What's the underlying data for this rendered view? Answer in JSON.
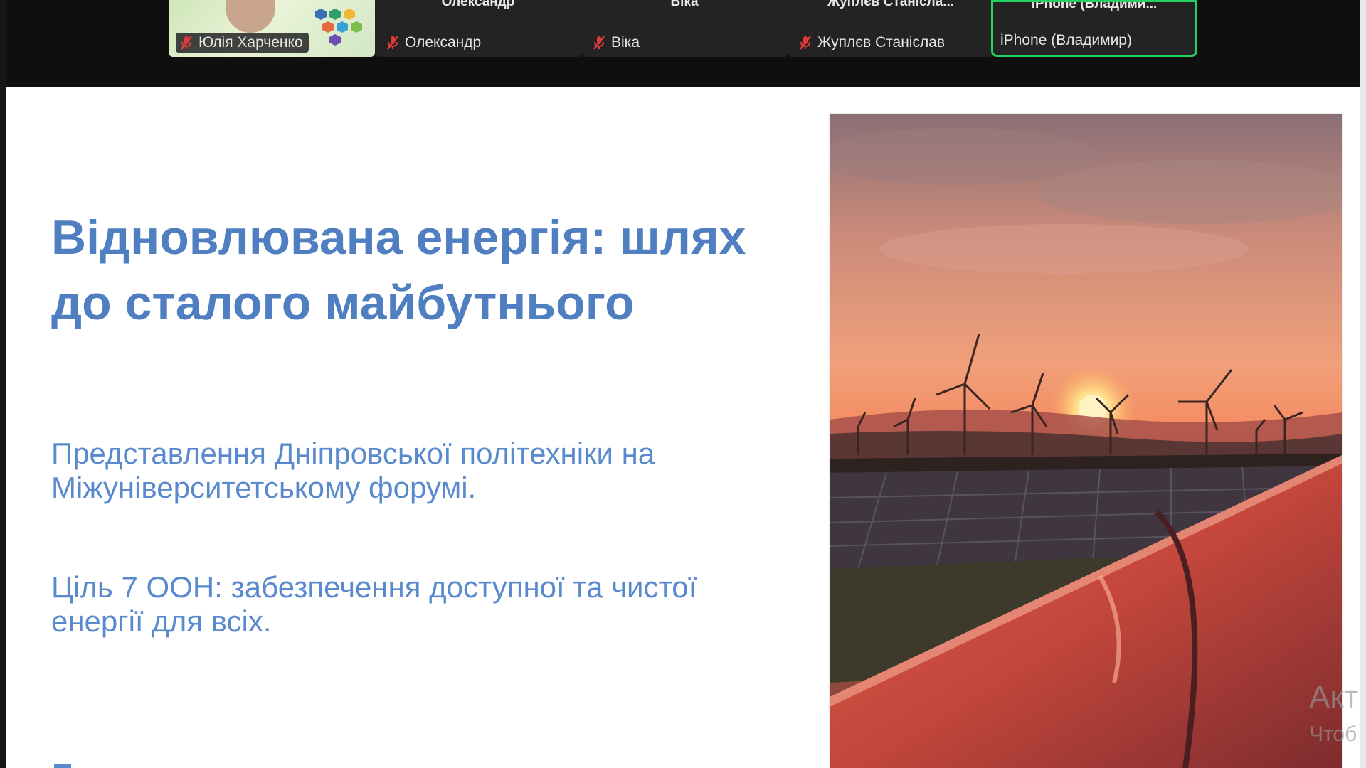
{
  "participants": [
    {
      "name": "Юлія Харченко",
      "top_name": "",
      "muted": true,
      "has_video": true,
      "active": false
    },
    {
      "name": "Олександр",
      "top_name": "Олександр",
      "muted": true,
      "has_video": false,
      "active": false
    },
    {
      "name": "Віка",
      "top_name": "Віка",
      "muted": true,
      "has_video": false,
      "active": false
    },
    {
      "name": "Жуплєв Станіслав",
      "top_name": "Жуплєв Станісла...",
      "muted": true,
      "has_video": false,
      "active": false
    },
    {
      "name": "iPhone (Владимир)",
      "top_name": "iPhone (Владими...",
      "muted": false,
      "has_video": false,
      "active": true
    }
  ],
  "slide": {
    "title": "Відновлювана енергія: шлях до сталого майбутнього",
    "subtitle_1": "Представлення Дніпровської політехніки на Міжуніверситетському форумі.",
    "subtitle_2": "Ціль 7 ООН: забезпечення доступної та чистої енергії для всіх."
  },
  "watermark": {
    "line1": "Акт",
    "line2": "Чтоб"
  },
  "colors": {
    "title": "#4f7fc1",
    "subtitle": "#5a8ace",
    "active_speaker": "#23d160",
    "muted_mic": "#e03b3b"
  },
  "icons": {
    "muted": "mic-muted-icon"
  }
}
